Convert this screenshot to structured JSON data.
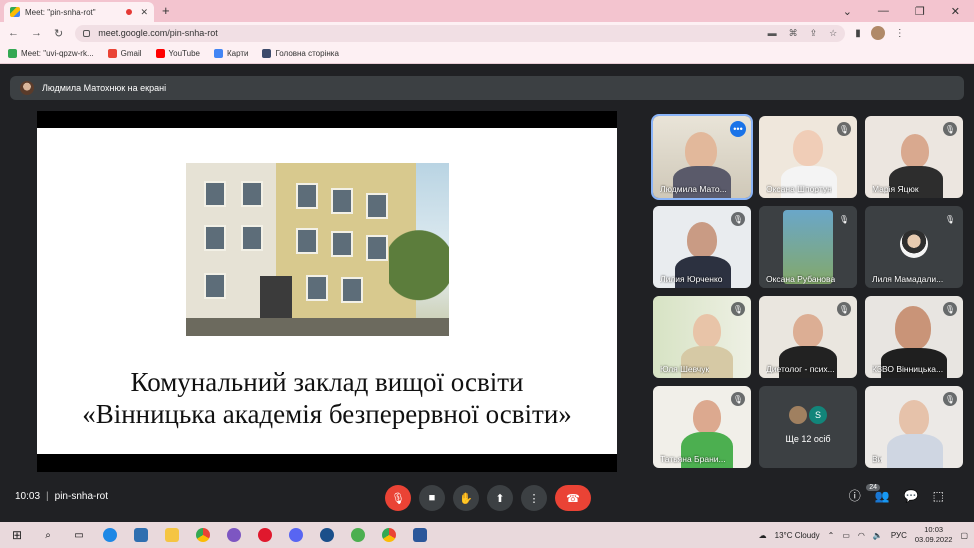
{
  "browser": {
    "tab_title": "Meet: \"pin-snha-rot\"",
    "tab_close": "✕",
    "new_tab": "+",
    "url": "meet.google.com/pin-snha-rot",
    "window_controls": [
      "⌄",
      "—",
      "❐",
      "✕"
    ],
    "bookmarks": [
      {
        "label": "Meet: \"uvi-qpzw-rk...",
        "icon": "meet-icon",
        "color": "#34a853"
      },
      {
        "label": "Gmail",
        "icon": "gmail-icon",
        "color": "#ea4335"
      },
      {
        "label": "YouTube",
        "icon": "youtube-icon",
        "color": "#ff0000"
      },
      {
        "label": "Карти",
        "icon": "maps-icon",
        "color": "#4285f4"
      },
      {
        "label": "Головна сторінка",
        "icon": "home-icon",
        "color": "#3c4a6b"
      }
    ]
  },
  "presentation": {
    "presenter_label": "Людмила Матохнюк на екрані",
    "slide_title_line1": "Комунальний заклад вищої освіти",
    "slide_title_line2": "«Вінницька академія безперервної освіти»"
  },
  "participants": [
    {
      "name": "Людмила Мато...",
      "active": true
    },
    {
      "name": "Оксана Шпортун"
    },
    {
      "name": "Марія Яцюк"
    },
    {
      "name": "Лилия Юрченко"
    },
    {
      "name": "Оксана Рубанова"
    },
    {
      "name": "Лиля Мамадали..."
    },
    {
      "name": "Юля Шевчук"
    },
    {
      "name": "Диетолог - псих..."
    },
    {
      "name": "КЗВО Вінницька..."
    },
    {
      "name": "Татьяна Брани..."
    },
    {
      "name": "Ще 12 осіб",
      "avatar_letter": "S"
    },
    {
      "name": "Ви"
    }
  ],
  "meeting": {
    "time": "10:03",
    "separator": "|",
    "code": "pin-snha-rot",
    "people_count": "24"
  },
  "taskbar": {
    "weather": "13°C  Cloudy",
    "language": "РУС",
    "time": "10:03",
    "date": "03.09.2022"
  }
}
